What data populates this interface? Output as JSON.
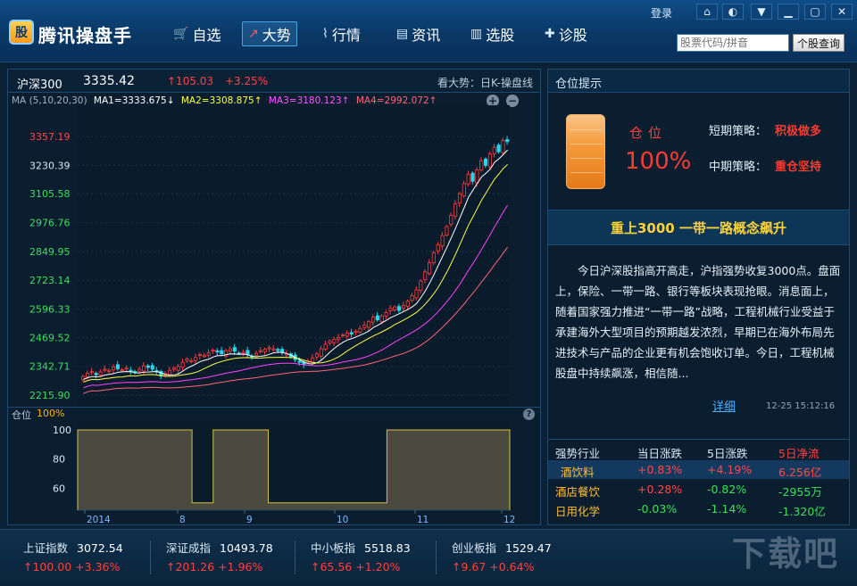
{
  "app": {
    "title": "腾讯操盘手",
    "logo_text": "股"
  },
  "nav": [
    {
      "label": "自选",
      "icon": "cart-icon",
      "glyph": "🛒"
    },
    {
      "label": "大势",
      "icon": "trend-icon",
      "glyph": "↗"
    },
    {
      "label": "行情",
      "icon": "line-chart-icon",
      "glyph": "⌇"
    },
    {
      "label": "资讯",
      "icon": "news-icon",
      "glyph": "▤"
    },
    {
      "label": "选股",
      "icon": "bar-chart-icon",
      "glyph": "▥"
    },
    {
      "label": "诊股",
      "icon": "medical-icon",
      "glyph": "✚"
    }
  ],
  "topbar": {
    "login": "登录",
    "search_placeholder": "股票代码/拼音",
    "query_button": "个股查询"
  },
  "index_header": {
    "name": "沪深300",
    "value": "3335.42",
    "change": "↑105.03",
    "pct": "+3.25%",
    "trend_label": "看大势：日K-操盘线"
  },
  "ma": {
    "prefix": "MA (5,10,20,30)",
    "ma1": "MA1=3333.675↓",
    "ma2": "MA2=3308.875↑",
    "ma3": "MA3=3180.123↑",
    "ma4": "MA4=2992.072↑",
    "colors": {
      "ma1": "#ffffff",
      "ma2": "#ffff44",
      "ma3": "#ff44ff",
      "ma4": "#ff6677"
    }
  },
  "chart_data": {
    "type": "candlestick",
    "y_ticks": [
      "3357.19",
      "3230.39",
      "3105.58",
      "2976.76",
      "2849.95",
      "2723.14",
      "2596.33",
      "2469.52",
      "2342.71",
      "2215.90"
    ],
    "ylim": [
      2215.9,
      3357.19
    ],
    "x_labels": [
      "2014",
      "8",
      "9",
      "10",
      "11",
      "12"
    ],
    "close": [
      2298,
      2312,
      2320,
      2305,
      2318,
      2330,
      2325,
      2340,
      2332,
      2328,
      2335,
      2322,
      2315,
      2330,
      2345,
      2338,
      2330,
      2318,
      2300,
      2310,
      2325,
      2335,
      2342,
      2360,
      2375,
      2368,
      2382,
      2395,
      2390,
      2402,
      2415,
      2408,
      2398,
      2412,
      2420,
      2410,
      2400,
      2405,
      2395,
      2388,
      2400,
      2412,
      2418,
      2425,
      2420,
      2412,
      2405,
      2398,
      2385,
      2372,
      2360,
      2352,
      2365,
      2380,
      2398,
      2420,
      2440,
      2455,
      2462,
      2470,
      2482,
      2490,
      2485,
      2498,
      2510,
      2525,
      2540,
      2560,
      2548,
      2565,
      2580,
      2598,
      2605,
      2590,
      2612,
      2630,
      2655,
      2680,
      2720,
      2760,
      2800,
      2845,
      2880,
      2920,
      2960,
      3010,
      3060,
      3105,
      3150,
      3190,
      3160,
      3210,
      3250,
      3230,
      3280,
      3310,
      3290,
      3340,
      3335
    ],
    "ma1": 3333.675,
    "ma2": 3308.875,
    "ma3": 3180.123,
    "ma4": 2992.072,
    "position": {
      "y_ticks": [
        "100",
        "80",
        "60"
      ],
      "ylim": [
        50,
        100
      ],
      "levels": [
        100,
        100,
        100,
        100,
        100,
        100,
        100,
        100,
        100,
        100,
        100,
        100,
        100,
        100,
        100,
        100,
        100,
        100,
        100,
        100,
        100,
        100,
        100,
        100,
        100,
        100,
        100,
        50,
        50,
        50,
        50,
        50,
        100,
        100,
        100,
        100,
        100,
        100,
        100,
        100,
        100,
        100,
        100,
        100,
        100,
        50,
        50,
        50,
        50,
        50,
        50,
        50,
        50,
        50,
        50,
        50,
        50,
        50,
        50,
        50,
        50,
        50,
        50,
        50,
        50,
        50,
        50,
        50,
        50,
        50,
        50,
        50,
        50,
        100,
        100,
        100,
        100,
        100,
        100,
        100,
        100,
        100,
        100,
        100,
        100,
        100,
        100,
        100,
        100,
        100,
        100,
        100,
        100,
        100,
        100,
        100,
        100,
        100,
        100,
        100,
        100,
        100
      ]
    }
  },
  "position_panel": {
    "label": "仓位",
    "pct": "100%"
  },
  "right_panel": {
    "title": "仓位提示",
    "pos_word": "仓位",
    "pos_value": "100%",
    "short_label": "短期策略：",
    "short_value": "积极做多",
    "mid_label": "中期策略：",
    "mid_value": "重仓坚持",
    "headline": "重上3000 一带一路概念飙升",
    "news": "今日沪深股指高开高走，沪指强势收复3000点。盘面上，保险、一带一路、银行等板块表现抢眼。消息面上，随着国家强力推进“一带一路”战略，工程机械行业受益于承建海外大型项目的预期越发浓烈，早期已在海外布局先进技术与产品的企业更有机会饱收订单。今日，工程机械股盘中持续飙涨，相信随...",
    "more": "详细",
    "time": "12-25 15:12:16"
  },
  "industry_table": {
    "headers": [
      "强势行业",
      "当日涨跌",
      "5日涨跌",
      "5日净流"
    ],
    "rows": [
      {
        "name": "酒饮料",
        "day": "+0.83%",
        "five": "+4.19%",
        "flow": "6.256亿"
      },
      {
        "name": "酒店餐饮",
        "day": "+0.28%",
        "five": "-0.82%",
        "flow": "-2955万"
      },
      {
        "name": "日用化学",
        "day": "-0.03%",
        "five": "-1.14%",
        "flow": "-1.320亿"
      }
    ]
  },
  "bottom": [
    {
      "name": "上证指数",
      "value": "3072.54",
      "change": "↑100.00 +3.36%"
    },
    {
      "name": "深证成指",
      "value": "10493.78",
      "change": "↑201.26 +1.96%"
    },
    {
      "name": "中小板指",
      "value": "5518.83",
      "change": "↑65.56 +1.20%"
    },
    {
      "name": "创业板指",
      "value": "1529.47",
      "change": "↑9.67 +0.64%"
    }
  ],
  "watermark": "下载吧"
}
